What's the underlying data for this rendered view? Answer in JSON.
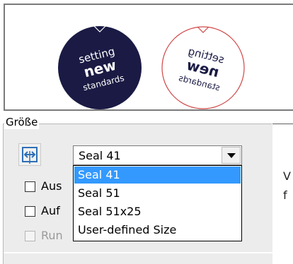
{
  "preview": {
    "seal_front_lines": [
      "setting",
      "new",
      "standards"
    ],
    "seal_mirror_lines": [
      "setting",
      "new",
      "standards"
    ],
    "seal_front_color": "#1a1a44",
    "seal_mirror_border_color": "#d04848"
  },
  "size_group": {
    "label": "Größe",
    "fit_icon": "fit-width-icon",
    "combo_value": "Seal 41",
    "options": [
      "Seal 41",
      "Seal 51",
      "Seal 51x25",
      "User-defined Size"
    ],
    "selected_index": 0,
    "checkboxes": [
      {
        "label": "Aus",
        "checked": false,
        "enabled": true
      },
      {
        "label": "Auf",
        "checked": false,
        "enabled": true
      },
      {
        "label": "Run",
        "checked": false,
        "enabled": false
      }
    ]
  },
  "right_panel": {
    "line1": "V",
    "line2": "f"
  },
  "colors": {
    "selection": "#3399ff",
    "panel": "#ececec"
  }
}
